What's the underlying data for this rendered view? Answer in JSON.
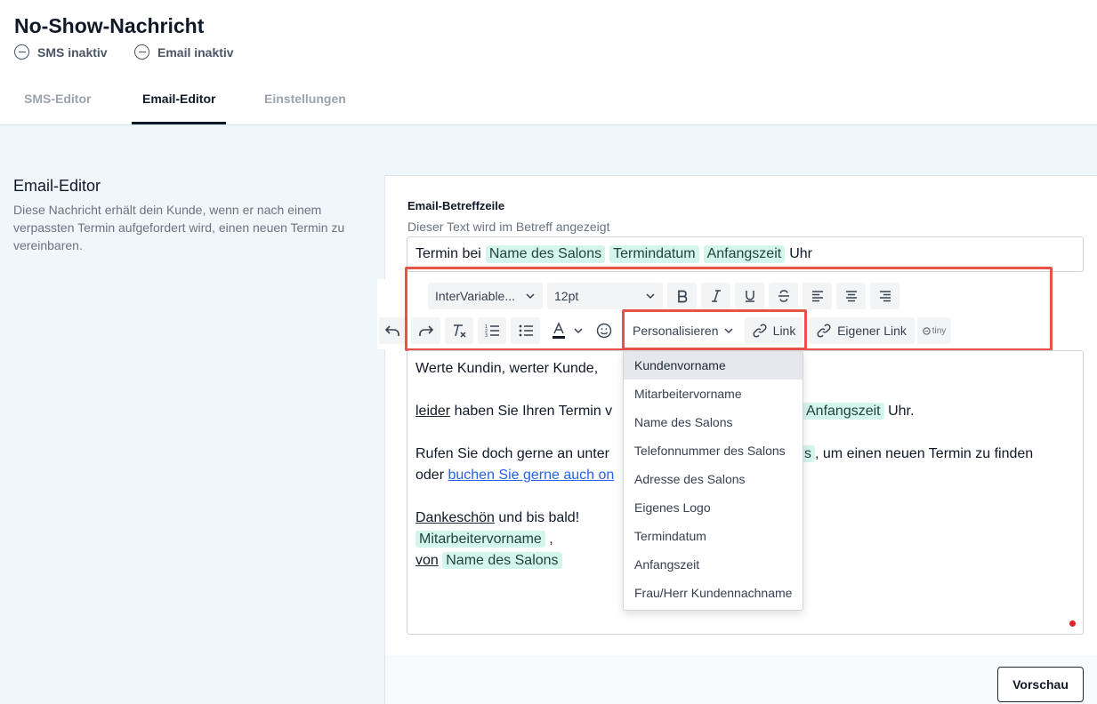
{
  "page": {
    "title": "No-Show-Nachricht",
    "status": [
      {
        "label": "SMS inaktiv",
        "icon": "minus-circle-icon"
      },
      {
        "label": "Email inaktiv",
        "icon": "minus-circle-icon"
      }
    ]
  },
  "tabs": [
    {
      "label": "SMS-Editor",
      "active": false
    },
    {
      "label": "Email-Editor",
      "active": true
    },
    {
      "label": "Einstellungen",
      "active": false
    }
  ],
  "section": {
    "title": "Email-Editor",
    "description": "Diese Nachricht erhält dein Kunde, wenn er nach einem verpassten Termin aufgefordert wird, einen neuen Termin zu vereinbaren."
  },
  "subject": {
    "label": "Email-Betreffzeile",
    "hint": "Dieser Text wird im Betreff angezeigt",
    "prefix": "Termin bei",
    "tags": [
      "Name des Salons",
      "Termindatum",
      "Anfangszeit"
    ],
    "suffix": "Uhr"
  },
  "toolbar": {
    "font_family": "InterVariable...",
    "font_size": "12pt",
    "personalize_label": "Personalisieren",
    "link_label": "Link",
    "custom_link_label": "Eigener Link",
    "tiny_label": "tiny"
  },
  "editor": {
    "line1": "Werte Kundin, werter Kunde,",
    "line2_word": "leider",
    "line2_text": "haben Sie Ihren Termin v",
    "line2_tag": "Anfangszeit",
    "line2_end": "Uhr.",
    "line3_text": "Rufen Sie doch gerne an unter",
    "line3_tag_tail": "s",
    "line3_end": ", um einen neuen Termin zu finden",
    "line4_text": "oder",
    "line4_link": "buchen Sie gerne auch on",
    "line5_word": "Dankeschön",
    "line5_text": "und bis bald!",
    "line6_tag": "Mitarbeitervorname",
    "line6_end": ",",
    "line7_word": "von",
    "line7_tag": "Name des Salons"
  },
  "dropdown": {
    "items": [
      "Kundenvorname",
      "Mitarbeitervorname",
      "Name des Salons",
      "Telefonnummer des Salons",
      "Adresse des Salons",
      "Eigenes Logo",
      "Termindatum",
      "Anfangszeit",
      "Frau/Herr Kundennachname"
    ],
    "highlighted_index": 0
  },
  "footer": {
    "preview_label": "Vorschau"
  },
  "colors": {
    "tag_bg": "#d3f5ec",
    "content_bg": "#f0f7fb",
    "highlight_border": "#e9524b"
  }
}
